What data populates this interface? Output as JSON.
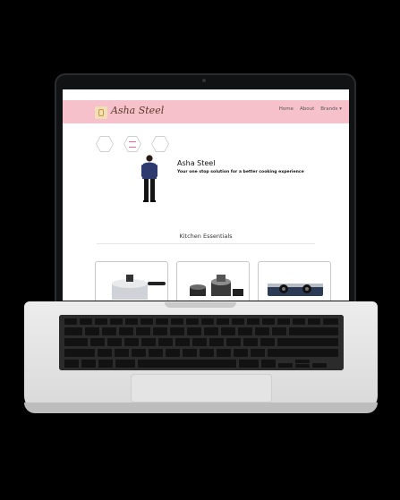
{
  "site": {
    "brand": "Asha Steel",
    "nav": {
      "home": "Home",
      "about": "About",
      "brands": "Brands",
      "brands_caret": "▾"
    },
    "hero": {
      "title": "Asha Steel",
      "subtitle": "Your one stop solution for a better cooking experience"
    },
    "section": {
      "title": "Kitchen Essentials"
    }
  },
  "colors": {
    "nav_bg": "#f7c1cc",
    "accent": "#e96a8a",
    "person_shirt": "#2f3b6e",
    "person_pants": "#151515"
  },
  "icons": [
    "hexagon-icon",
    "hexagon-menu-icon",
    "hexagon-icon",
    "cooker-icon",
    "mixer-icon",
    "gas-stove-icon",
    "camera-icon"
  ]
}
